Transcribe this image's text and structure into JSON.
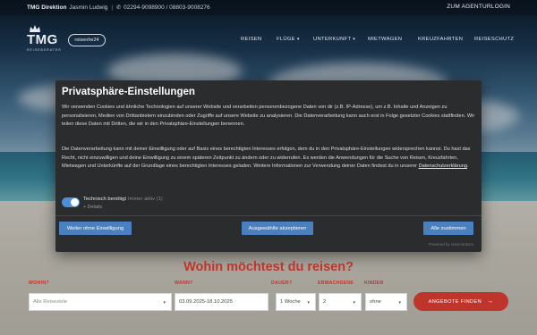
{
  "topbar": {
    "brand": "TMG Direktion",
    "person": "Jasmin Ludwig",
    "phones": "02294-9098900 / 08803-9008276",
    "agent_login": "ZUM AGENTURLOGIN"
  },
  "logos": {
    "tmg": "TMG",
    "tmg_sub": "REISEBERATER",
    "partner": "reisenhe24"
  },
  "nav": {
    "items": [
      {
        "label": "REISEN",
        "dropdown": false
      },
      {
        "label": "FLÜGE",
        "dropdown": true
      },
      {
        "label": "UNTERKUNFT",
        "dropdown": true
      },
      {
        "label": "MIETWAGEN",
        "dropdown": false
      },
      {
        "label": "KREUZFAHRTEN",
        "dropdown": false
      },
      {
        "label": "REISESCHUTZ",
        "dropdown": false
      }
    ]
  },
  "modal": {
    "title": "Privatsphäre-Einstellungen",
    "paragraph1": "Wir verwenden Cookies und ähnliche Technologien auf unserer Website und verarbeiten personenbezogene Daten von dir (z.B. IP-Adresse), um z.B. Inhalte und Anzeigen zu personalisieren, Medien von Drittanbietern einzubinden oder Zugriffe auf unsere Website zu analysieren. Die Datenverarbeitung kann auch erst in Folge gesetzter Cookies stattfinden. Wir teilen diese Daten mit Dritten, die wir in den Privatsphäre-Einstellungen benennen.",
    "paragraph2": "Die Datenverarbeitung kann mit deiner Einwilligung oder auf Basis eines berechtigten Interesses erfolgen, dem du in den Privatsphäre-Einstellungen widersprechen kannst. Du hast das Recht, nicht einzuwilligen und deine Einwilligung zu einem späteren Zeitpunkt zu ändern oder zu widerrufen. Es werden die Anwendungen für die Suche von Reisen, Kreuzfahrten, Mietwagen und Unterkünfte auf der Grundlage eines berechtigten Interesses geladen. Weitere Informationen zur Verwendung deiner Daten findest du in unserer",
    "privacy_link": "Datenschutzerklärung",
    "after_link": ".",
    "tech_label": "Technisch benötigt",
    "tech_muted": "Immer aktiv (1)",
    "tech_details": "+ Details",
    "btn_without": "Weiter ohne Einwilligung",
    "btn_selected": "Ausgewählte akzeptieren",
    "btn_all": "Alle zustimmen",
    "powered": "Powered by Usercentrics"
  },
  "search": {
    "headline": "Wohin möchtest du reisen?",
    "fields": [
      {
        "label": "WOHIN?",
        "value": "Alle Reiseziele"
      },
      {
        "label": "WANN?",
        "value": "03.09.2025-18.10.2025"
      },
      {
        "label": "DAUER?",
        "value": "1 Woche"
      },
      {
        "label": "ERWACHSENE",
        "value": "2"
      },
      {
        "label": "KINDER",
        "value": "ohne"
      }
    ],
    "button": "ANGEBOTE FINDEN",
    "button_arrow": "→"
  },
  "colors": {
    "accent_red": "#c0352b",
    "button_blue": "#4a7fc0",
    "modal_bg": "#2b2c2e",
    "toggle_on": "#4a8fd8"
  },
  "icons": {
    "phone": "phone-icon",
    "dropdown": "chevron-down-icon",
    "search_arrow": "arrow-right-icon"
  }
}
